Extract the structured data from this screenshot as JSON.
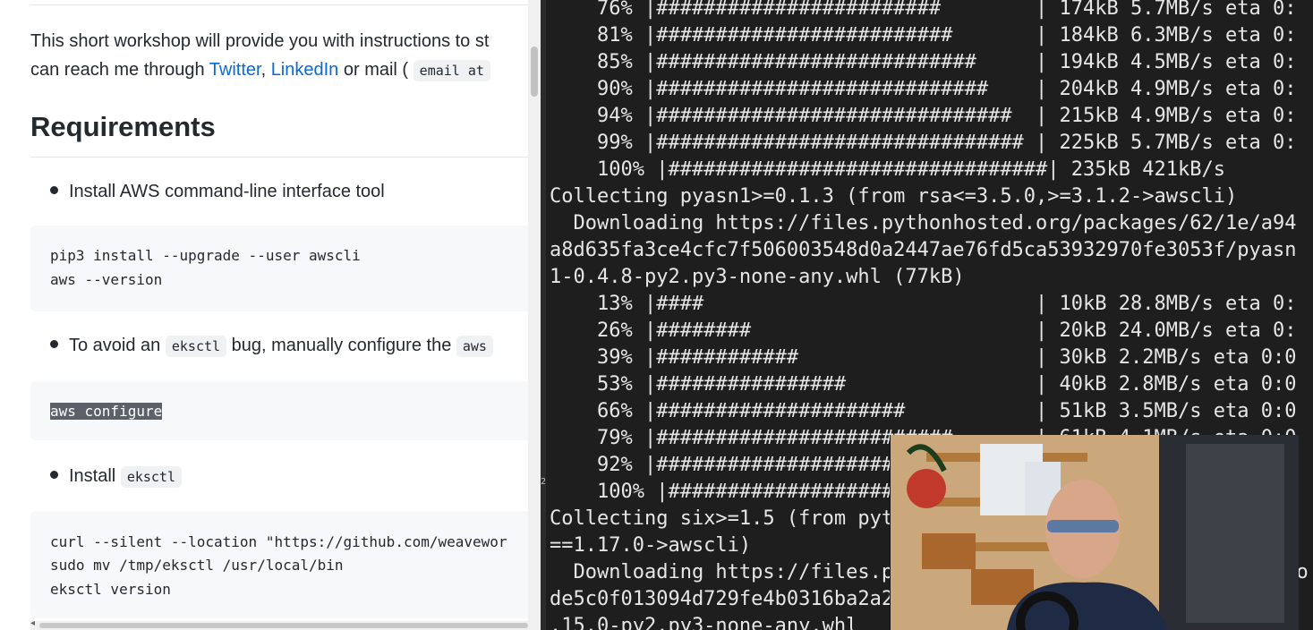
{
  "doc": {
    "intro_line1": "This short workshop will provide you with instructions to st",
    "intro_line2_prefix": "can reach me through ",
    "link_twitter": "Twitter",
    "comma": ", ",
    "link_linkedin": "LinkedIn",
    "intro_line2_mid": " or mail (",
    "mail_code": "email at ",
    "heading": "Requirements",
    "bullet1": "Install AWS command-line interface tool",
    "code1": [
      "pip3 install --upgrade --user awscli",
      "aws --version"
    ],
    "bullet2_pre": "To avoid an ",
    "bullet2_code1": "eksctl",
    "bullet2_mid": " bug, manually configure the ",
    "bullet2_code2": "aws",
    "code2_selected": "aws configure",
    "bullet3_pre": "Install ",
    "bullet3_code": "eksctl",
    "code3": [
      "curl --silent --location \"https://github.com/weavewor",
      "sudo mv /tmp/eksctl /usr/local/bin",
      "eksctl version"
    ]
  },
  "terminal": {
    "lines": [
      "    76% |########################        | 174kB 5.7MB/s eta 0:",
      "    81% |#########################       | 184kB 6.3MB/s eta 0:",
      "    85% |###########################     | 194kB 4.5MB/s eta 0:",
      "    90% |############################    | 204kB 4.9MB/s eta 0:",
      "    94% |##############################  | 215kB 4.9MB/s eta 0:",
      "    99% |############################### | 225kB 5.7MB/s eta 0:",
      "    100% |################################| 235kB 421kB/s",
      "Collecting pyasn1>=0.1.3 (from rsa<=3.5.0,>=3.1.2->awscli)",
      "  Downloading https://files.pythonhosted.org/packages/62/1e/a94",
      "a8d635fa3ce4cfc7f506003548d0a2447ae76fd5ca53932970fe3053f/pyasn",
      "1-0.4.8-py2.py3-none-any.whl (77kB)",
      "    13% |####                            | 10kB 28.8MB/s eta 0:",
      "    26% |########                        | 20kB 24.0MB/s eta 0:",
      "    39% |############                    | 30kB 2.2MB/s eta 0:0",
      "    53% |################                | 40kB 2.8MB/s eta 0:0",
      "    66% |#####################           | 51kB 3.5MB/s eta 0:0",
      "    79% |#########################       | 61kB 4.1MB/s eta 0:0",
      "    92% |#############################   | 71kB 3.1MB/s eta 0:0",
      "    100% |################################| 81kB 3.5MB/s",
      "Collecting six>=1.5 (from python-dateutil<3.0.0,>=2.1->botocore",
      "==1.17.0->awscli)",
      "  Downloading https://files.pythonhosted.org/packages/ee/ff/48bo",
      "de5c0f013094d729fe4b0316ba2a24de4a2c5b8a8a4a4b9f1c0b6ac57f3eL",
      ".15.0-py2.py3-none-any.whl"
    ]
  }
}
